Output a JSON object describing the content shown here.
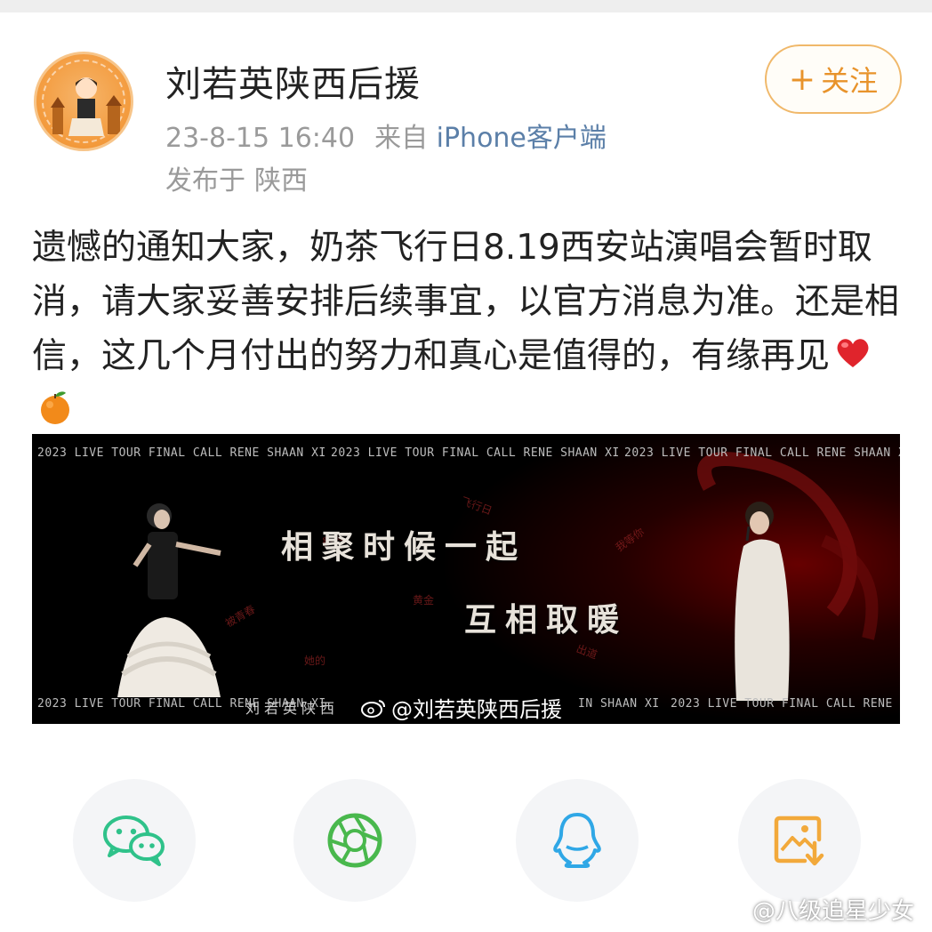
{
  "post": {
    "author_name": "刘若英陕西后援",
    "follow_label": "关注",
    "follow_plus": "+",
    "date_time": "23-8-15 16:40",
    "source_prefix": "来自",
    "source_client": "iPhone客户端",
    "location_prefix": "发布于",
    "location": "陕西",
    "text": "遗憾的通知大家，奶茶飞行日8.19西安站演唱会暂时取消，请大家妥善安排后续事宜，以官方消息为准。还是相信，这几个月付出的努力和真心是值得的，有缘再见",
    "emojis": [
      "heart-emoji",
      "tangerine-emoji"
    ]
  },
  "banner": {
    "tour_line": "2023 LIVE TOUR FINAL CALL RENE SHAAN XI",
    "tour_line_tail": "IN SHAAN XI",
    "slogan_1": "相聚时候一起",
    "slogan_2": "互相取暖",
    "tagline": "刘若英陕西",
    "watermark": "@刘若英陕西后援",
    "floating_words": [
      "飞行日",
      "黄金",
      "我等你",
      "她的",
      "被青春",
      "最美",
      "出道"
    ]
  },
  "share": [
    {
      "name": "wechat",
      "icon": "wechat-icon",
      "color": "#2fc28a"
    },
    {
      "name": "moments",
      "icon": "moments-icon",
      "color": "#49b84d"
    },
    {
      "name": "qq",
      "icon": "qq-icon",
      "color": "#2fa7e6"
    },
    {
      "name": "save-image",
      "icon": "save-image-icon",
      "color": "#f2a93b"
    }
  ],
  "page_watermark": "@八级追星少女"
}
